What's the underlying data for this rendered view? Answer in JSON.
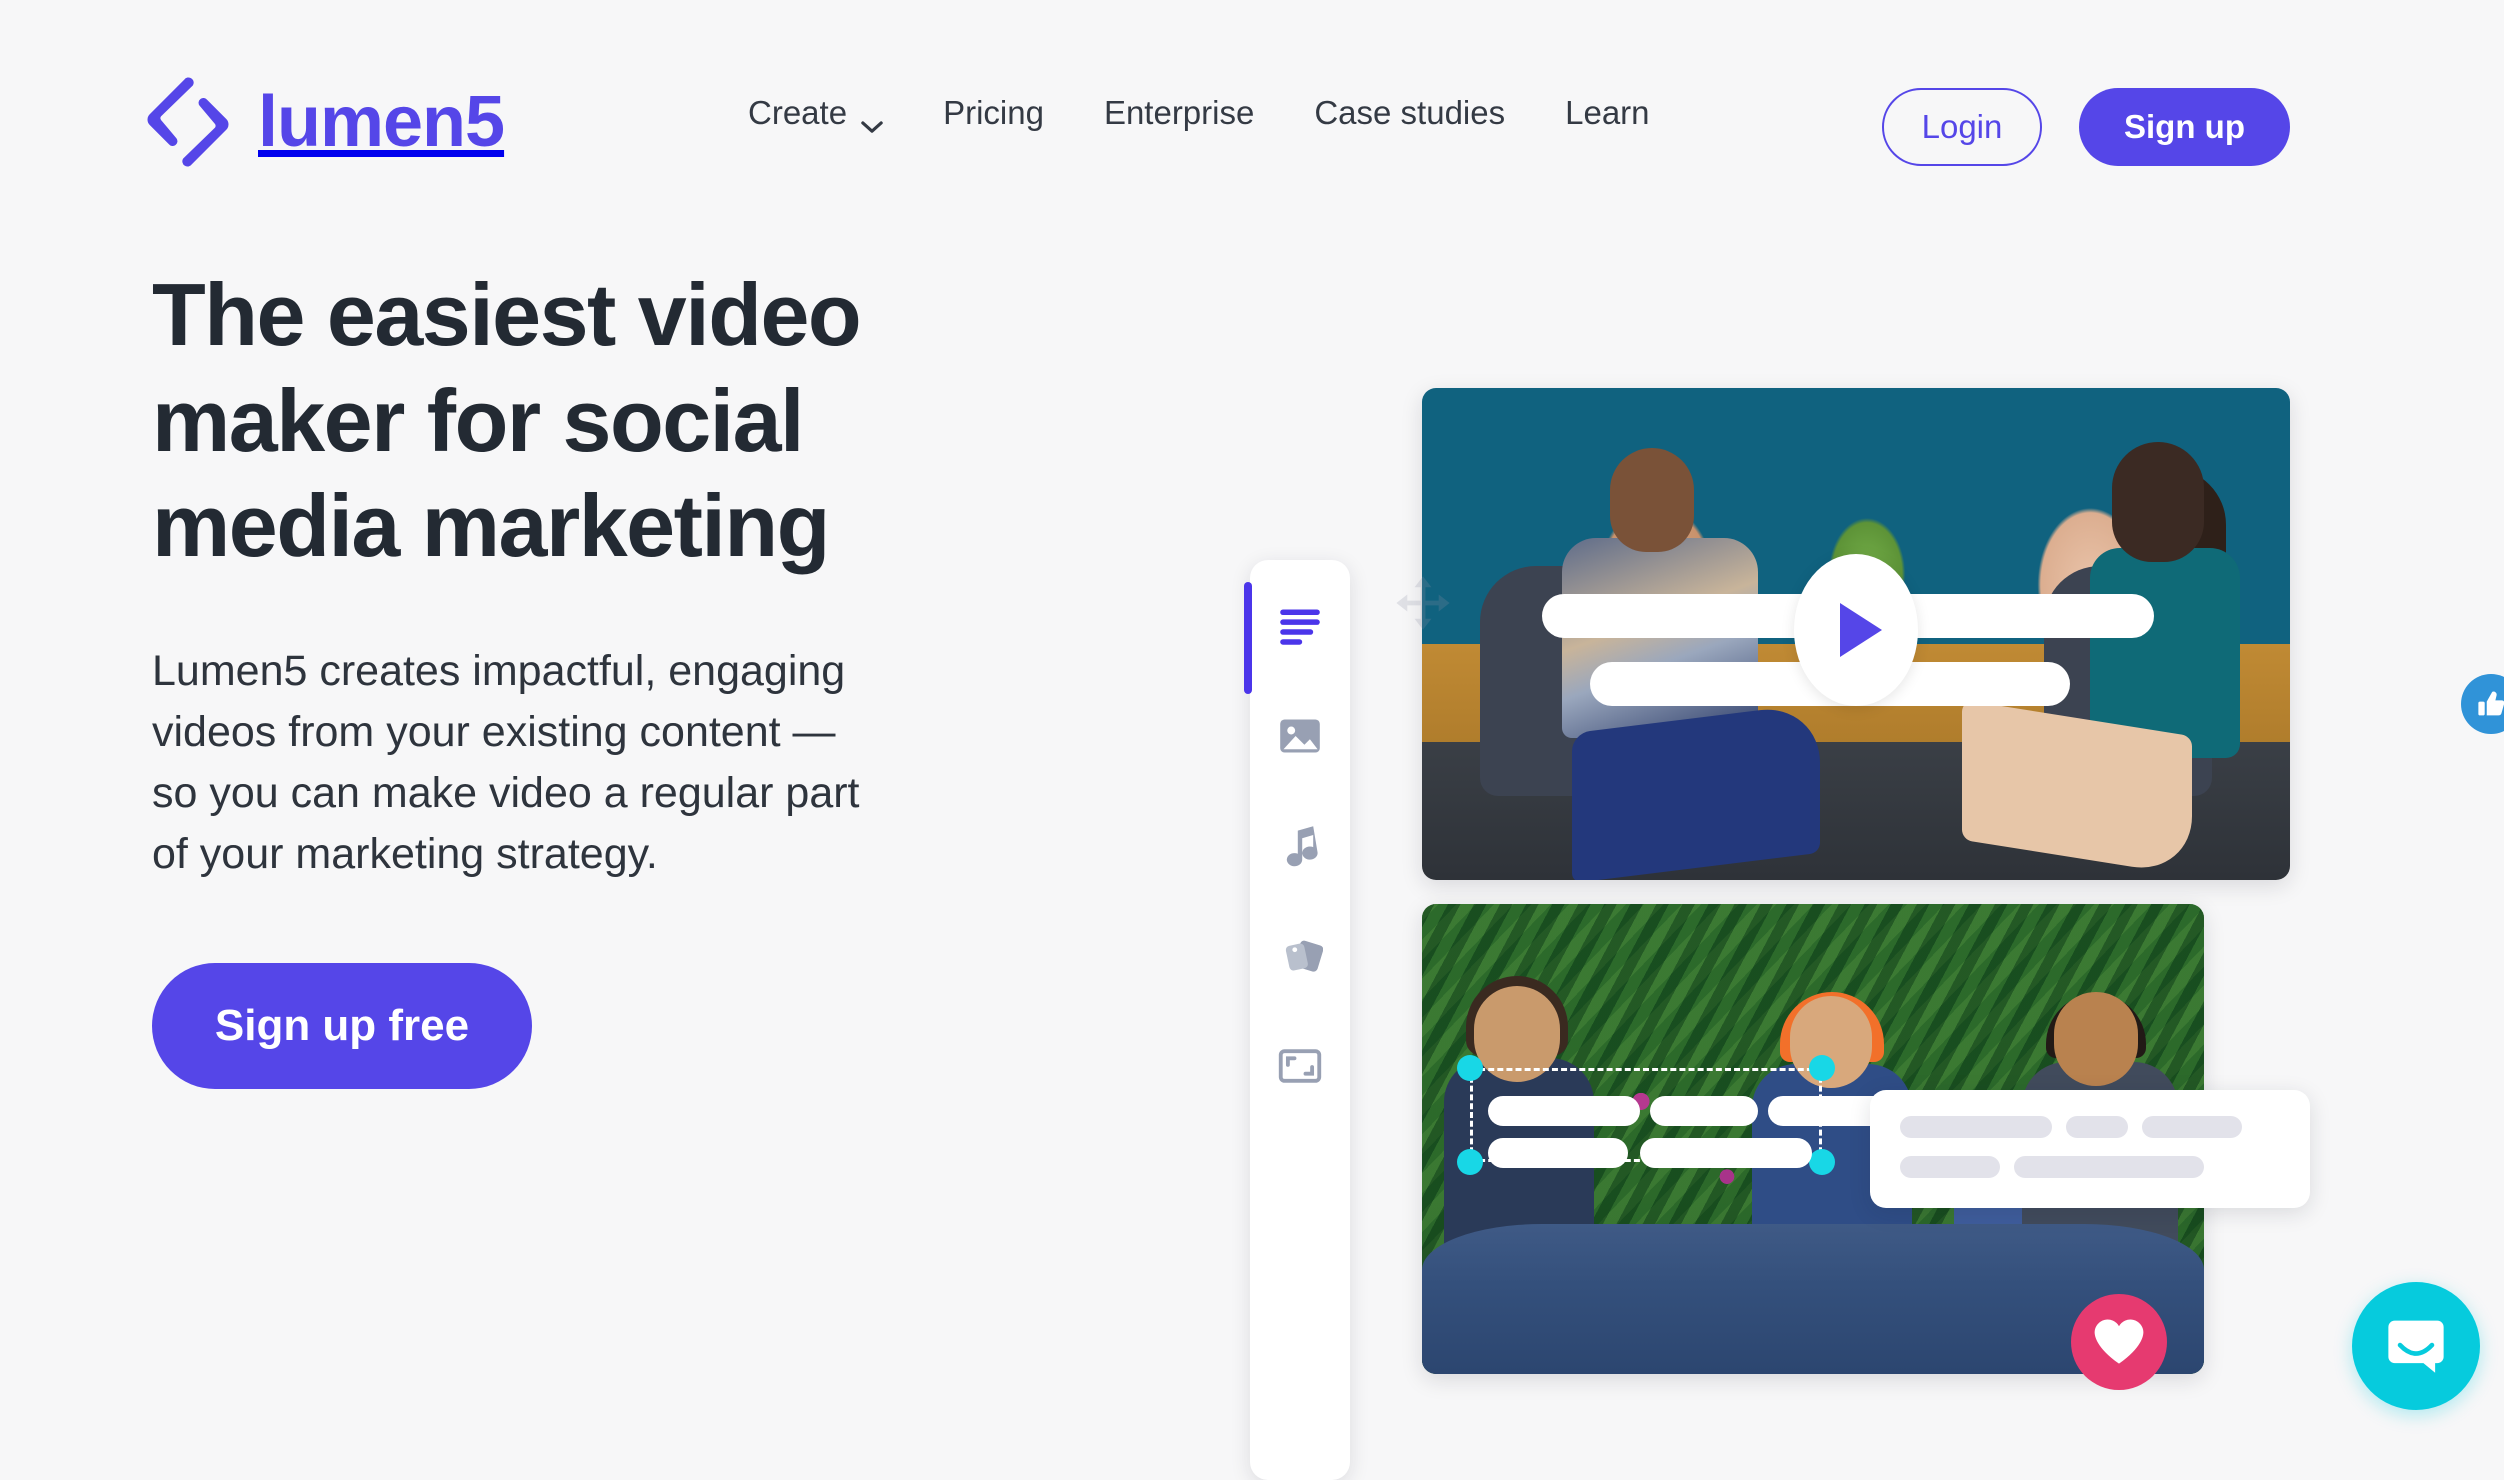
{
  "brand": {
    "name": "lumen5",
    "logo_icon": "lumen5-logo-icon",
    "accent_color": "#5546e8"
  },
  "nav": {
    "items": [
      {
        "label": "Create",
        "has_dropdown": true,
        "icon": "chevron-down-icon"
      },
      {
        "label": "Pricing",
        "has_dropdown": false
      },
      {
        "label": "Enterprise",
        "has_dropdown": false
      },
      {
        "label": "Case studies",
        "has_dropdown": false
      },
      {
        "label": "Learn",
        "has_dropdown": false
      }
    ],
    "login_label": "Login",
    "signup_label": "Sign up"
  },
  "hero": {
    "title": "The easiest video maker for social media marketing",
    "subtitle": "Lumen5 creates impactful, engaging videos from your existing content — so you can make video a regular part of your marketing strategy.",
    "cta_label": "Sign up free"
  },
  "editor_mock": {
    "play_button_icon": "play-triangle-icon",
    "toolbar": [
      {
        "icon": "text-lines-icon",
        "label": "Text",
        "active": true
      },
      {
        "icon": "image-icon",
        "label": "Media",
        "active": false
      },
      {
        "icon": "music-note-icon",
        "label": "Music",
        "active": false
      },
      {
        "icon": "stickers-icon",
        "label": "Stickers",
        "active": false
      },
      {
        "icon": "resize-frame-icon",
        "label": "Format",
        "active": false
      }
    ],
    "move_cursor_icon": "move-arrows-icon",
    "selection_handles": 4,
    "colors": {
      "selection_handle": "#18d7e6",
      "active_tool": "#4b35ea",
      "placeholder_bar": "#e2e2ea"
    }
  },
  "reactions": [
    {
      "icon": "thumbs-up-icon",
      "color": "#3093d8"
    },
    {
      "icon": "heart-icon",
      "color": "#e63a70"
    }
  ],
  "chat_widget": {
    "icon": "chat-bubble-smile-icon",
    "color": "#06cbdd"
  }
}
